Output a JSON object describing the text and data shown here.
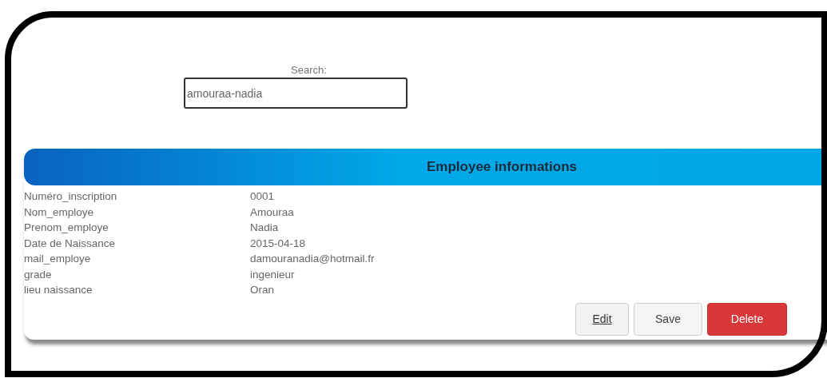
{
  "search": {
    "label": "Search:",
    "value": "amouraa-nadia"
  },
  "panel": {
    "title": "Employee informations",
    "fields": [
      {
        "label": "Numéro_inscription",
        "value": "0001"
      },
      {
        "label": "Nom_employe",
        "value": "Amouraa"
      },
      {
        "label": "Prenom_employe",
        "value": "Nadia"
      },
      {
        "label": "Date de Naissance",
        "value": "2015-04-18"
      },
      {
        "label": "mail_employe",
        "value": "damouranadia@hotmail.fr"
      },
      {
        "label": "grade",
        "value": "ingenieur"
      },
      {
        "label": "lieu naissance",
        "value": "Oran"
      }
    ],
    "buttons": [
      {
        "label": "Edit",
        "kind": "link"
      },
      {
        "label": "Save",
        "kind": "default"
      },
      {
        "label": "Delete",
        "kind": "danger"
      }
    ]
  }
}
